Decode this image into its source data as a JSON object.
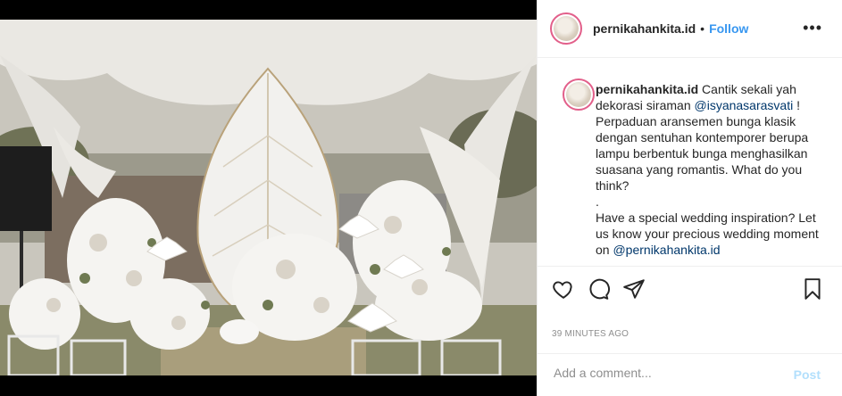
{
  "post": {
    "username": "pernikahankita.id",
    "separator": "•",
    "follow_label": "Follow",
    "more_icon": "more-horizontal-icon"
  },
  "caption": {
    "username": "pernikahankita.id",
    "line1": " Cantik sekali yah dekorasi siraman ",
    "mention1": "@isyanasarasvati",
    "line1_end": " !",
    "para1": "Perpaduan aransemen bunga klasik dengan sentuhan kontemporer berupa lampu berbentuk bunga menghasilkan suasana yang romantis. What do you think?",
    "dot_line": ".",
    "para2_start": "Have a special wedding inspiration? Let us know your precious wedding moment on ",
    "mention2": "@pernikahankita.id"
  },
  "actions": {
    "like_icon": "heart-icon",
    "comment_icon": "comment-icon",
    "share_icon": "paper-plane-icon",
    "save_icon": "bookmark-icon"
  },
  "timestamp": "39 MINUTES AGO",
  "comment_box": {
    "placeholder": "Add a comment...",
    "post_label": "Post"
  },
  "colors": {
    "link": "#3897f0",
    "mention": "#00376b",
    "post_disabled": "#b2dffc",
    "story_ring": "#e25f8a"
  }
}
